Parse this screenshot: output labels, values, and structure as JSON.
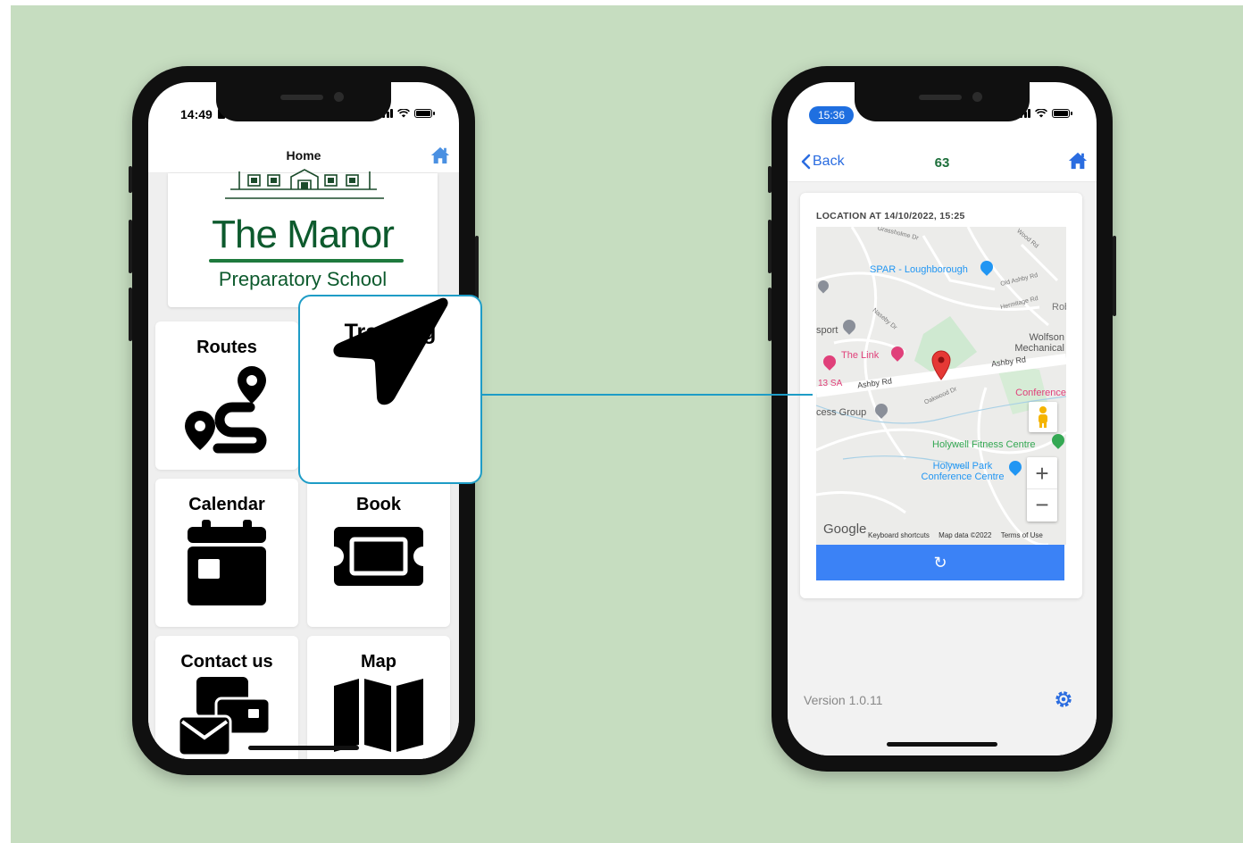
{
  "left_phone": {
    "status_time": "14:49",
    "nav_title": "Home",
    "logo": {
      "name": "The Manor",
      "subtitle": "Preparatory School"
    },
    "tiles": [
      {
        "label": "Routes",
        "icon": "route-icon"
      },
      {
        "label": "Tracking",
        "icon": "navigation-arrow-icon"
      },
      {
        "label": "Calendar",
        "icon": "calendar-icon"
      },
      {
        "label": "Book",
        "icon": "ticket-icon"
      },
      {
        "label": "Contact us",
        "icon": "contact-icon"
      },
      {
        "label": "Map",
        "icon": "map-icon"
      }
    ]
  },
  "right_phone": {
    "status_time": "15:36",
    "nav": {
      "back_label": "Back",
      "title": "63"
    },
    "location_title": "LOCATION AT 14/10/2022, 15:25",
    "map": {
      "places": [
        "SPAR - Loughborough",
        "The Link",
        "Holywell Fitness Centre",
        "Holywell Park Conference Centre",
        "Wolfson Mechanical",
        "Conference",
        "cess Group",
        "sport",
        "13 SA"
      ],
      "roads": [
        "Ashby Rd",
        "Ashby Rd",
        "Oakwood Dr",
        "Old Ashby Rd",
        "Hermitage Rd",
        "Naseby Dr",
        "Grassholme Dr",
        "Wood Rd",
        "Rob"
      ],
      "logo": "Google",
      "footer": [
        "Keyboard shortcuts",
        "Map data ©2022",
        "Terms of Use"
      ],
      "zoom_in": "+",
      "zoom_out": "−"
    },
    "refresh_icon": "↻",
    "version": "Version 1.0.11"
  },
  "colors": {
    "background": "#c6ddc0",
    "brand_green": "#0d5a2d",
    "accent_blue": "#3b82f6",
    "callout_border": "#1e9cc6",
    "ios_blue": "#2a6ce0"
  }
}
